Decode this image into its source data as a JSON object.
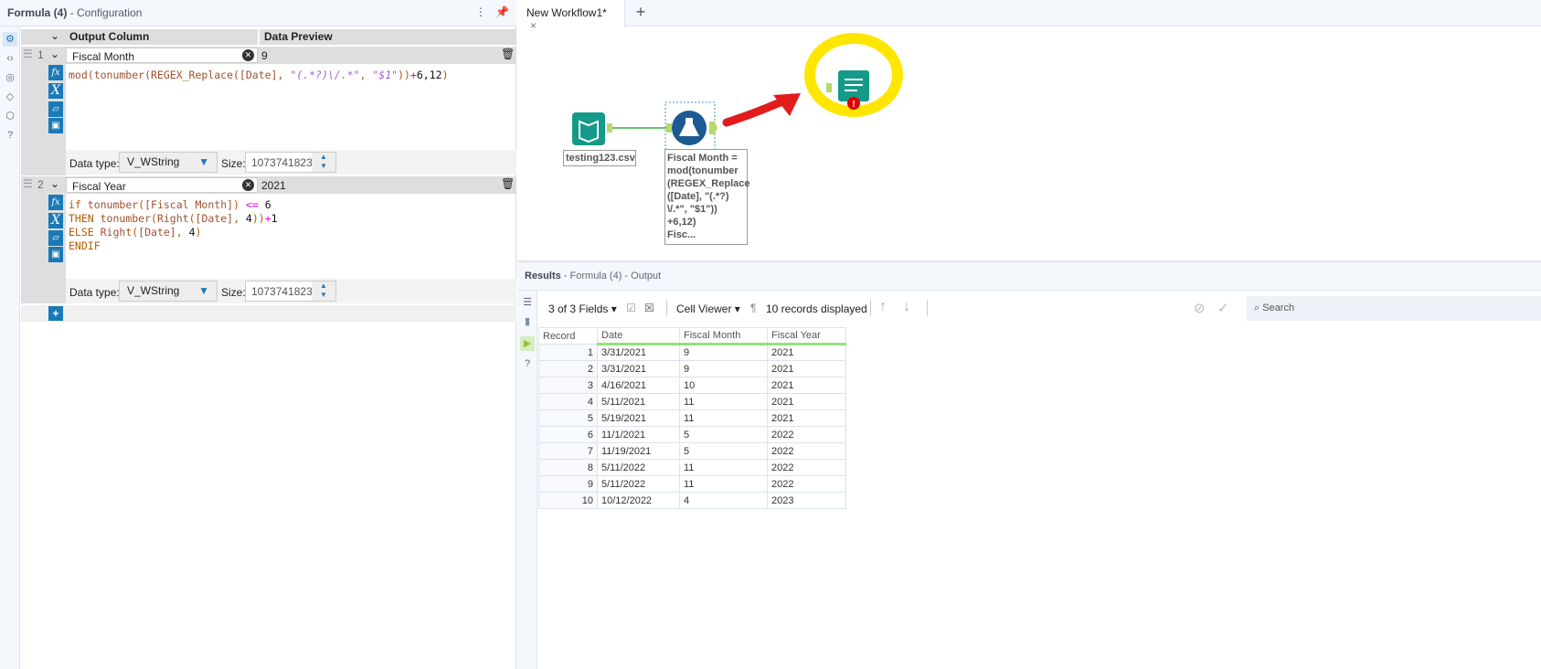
{
  "config": {
    "title_tool": "Formula (4)",
    "title_rest": " - Configuration",
    "headers": {
      "output_column": "Output Column",
      "data_preview": "Data Preview"
    },
    "rows": [
      {
        "num": "1",
        "name": "Fiscal Month",
        "preview": "9",
        "datatype_label": "Data type:",
        "datatype": "V_WString",
        "size_label": "Size:",
        "size": "1073741823"
      },
      {
        "num": "2",
        "name": "Fiscal Year",
        "preview": "2021",
        "datatype_label": "Data type:",
        "datatype": "V_WString",
        "size_label": "Size:",
        "size": "1073741823"
      }
    ],
    "add_label": "+"
  },
  "tabs": {
    "active": "New Workflow1*",
    "close": "×",
    "add": "+"
  },
  "canvas": {
    "input_label": "testing123.csv",
    "formula_annotation": [
      "Fiscal Month =",
      "mod(tonumber",
      "(REGEX_Replace",
      "([Date], \"(.*?)",
      "\\/.*\", \"$1\"))",
      "+6,12)",
      "Fisc..."
    ],
    "colors": {
      "green": "#159a8a",
      "blue": "#1c5a93",
      "annotation_arrow": "#e21b1b",
      "highlight": "#ffe600"
    }
  },
  "results": {
    "title": "Results",
    "subtitle": " - Formula (4) - Output",
    "fields": "3 of 3 Fields",
    "cell_viewer": "Cell Viewer",
    "records": "10 records displayed",
    "search_placeholder": "Search",
    "columns": [
      "Record",
      "Date",
      "Fiscal Month",
      "Fiscal Year"
    ],
    "rows": [
      [
        "1",
        "3/31/2021",
        "9",
        "2021"
      ],
      [
        "2",
        "3/31/2021",
        "9",
        "2021"
      ],
      [
        "3",
        "4/16/2021",
        "10",
        "2021"
      ],
      [
        "4",
        "5/11/2021",
        "11",
        "2021"
      ],
      [
        "5",
        "5/19/2021",
        "11",
        "2021"
      ],
      [
        "6",
        "11/1/2021",
        "5",
        "2022"
      ],
      [
        "7",
        "11/19/2021",
        "5",
        "2022"
      ],
      [
        "8",
        "5/11/2022",
        "11",
        "2022"
      ],
      [
        "9",
        "5/11/2022",
        "11",
        "2022"
      ],
      [
        "10",
        "10/12/2022",
        "4",
        "2023"
      ]
    ]
  }
}
